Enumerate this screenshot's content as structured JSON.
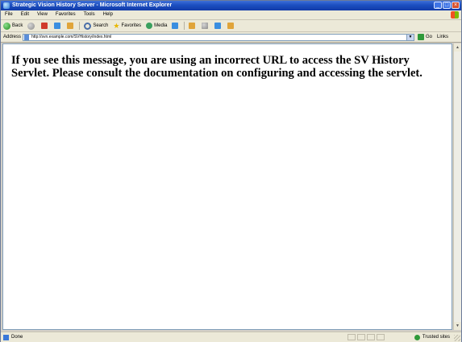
{
  "window": {
    "title": "Strategic Vision History Server - Microsoft Internet Explorer"
  },
  "menu": {
    "items": [
      "File",
      "Edit",
      "View",
      "Favorites",
      "Tools",
      "Help"
    ]
  },
  "toolbar": {
    "back_label": "Back",
    "search_label": "Search",
    "favorites_label": "Favorites",
    "media_label": "Media"
  },
  "address": {
    "label": "Address",
    "url": "http://svn.example.com/SVHistory/index.html",
    "go_label": "Go",
    "links_label": "Links"
  },
  "content": {
    "message": "If you see this message, you are using an incorrect URL to access the SV History Servlet. Please consult the documentation on configuring and accessing the servlet."
  },
  "status": {
    "text": "Done",
    "zone": "Trusted sites"
  }
}
